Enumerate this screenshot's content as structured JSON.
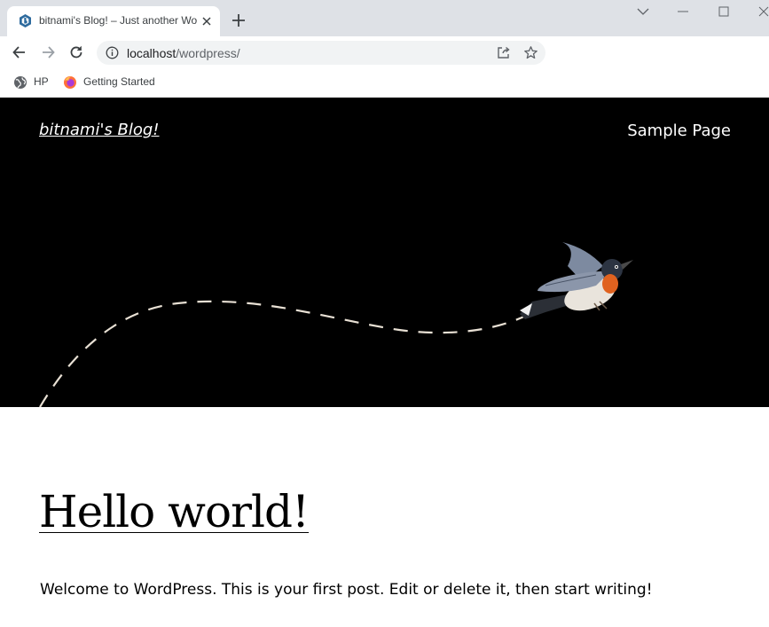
{
  "browser": {
    "tab": {
      "title": "bitnami's Blog! – Just another WordPress site",
      "favicon": "bitnami-hexagon-icon"
    },
    "address_bar": {
      "host": "localhost",
      "path": "/wordpress/"
    },
    "bookmarks": [
      {
        "label": "HP",
        "icon": "globe-icon"
      },
      {
        "label": "Getting Started",
        "icon": "firefox-icon"
      }
    ],
    "colors": {
      "tabstrip": "#dee1e6",
      "omnibox": "#f1f3f4"
    }
  },
  "site": {
    "title": "bitnami's Blog!",
    "nav": [
      "Sample Page"
    ],
    "header_background": "#000000"
  },
  "post": {
    "title": "Hello world!",
    "excerpt": "Welcome to WordPress. This is your first post. Edit or delete it, then start writing!"
  }
}
